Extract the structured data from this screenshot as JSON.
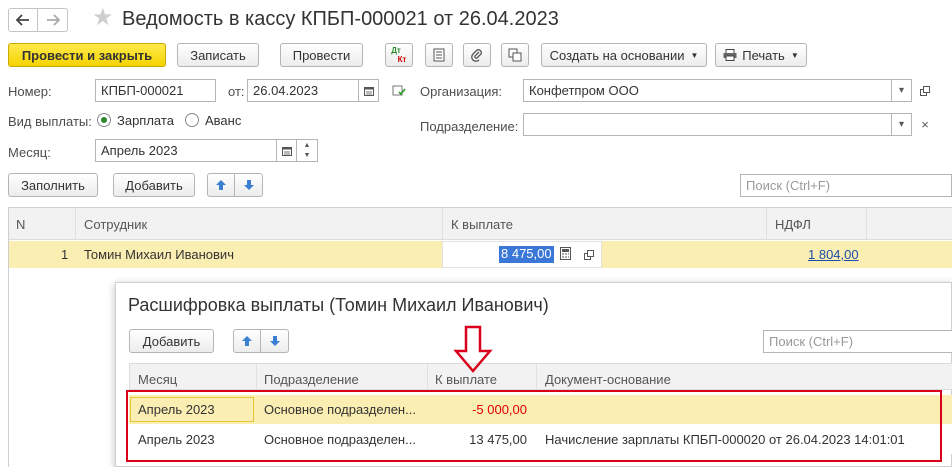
{
  "window": {
    "title": "Ведомость в кассу КПБП-000021 от 26.04.2023"
  },
  "toolbar": {
    "post_close": "Провести и закрыть",
    "save": "Записать",
    "post": "Провести",
    "dtkt_top": "Дт",
    "dtkt_bottom": "Кт",
    "create_based": "Создать на основании",
    "print": "Печать"
  },
  "form": {
    "number_label": "Номер:",
    "number_value": "КПБП-000021",
    "from_label": "от:",
    "date_value": "26.04.2023",
    "org_label": "Организация:",
    "org_value": "Конфетпром ООО",
    "pay_type_label": "Вид выплаты:",
    "pay_type_salary": "Зарплата",
    "pay_type_advance": "Аванс",
    "dept_label": "Подразделение:",
    "dept_value": "",
    "month_label": "Месяц:",
    "month_value": "Апрель 2023"
  },
  "actions": {
    "fill": "Заполнить",
    "add": "Добавить",
    "search_placeholder": "Поиск (Ctrl+F)"
  },
  "main_table": {
    "headers": {
      "n": "N",
      "employee": "Сотрудник",
      "to_pay": "К выплате",
      "ndfl": "НДФЛ"
    },
    "rows": [
      {
        "n": "1",
        "employee": "Томин Михаил Иванович",
        "to_pay": "8 475,00",
        "ndfl": "1 804,00"
      }
    ]
  },
  "popup": {
    "title": "Расшифровка выплаты (Томин Михаил Иванович)",
    "add": "Добавить",
    "search_placeholder": "Поиск (Ctrl+F)",
    "headers": {
      "month": "Месяц",
      "dept": "Подразделение",
      "to_pay": "К выплате",
      "doc": "Документ-основание"
    },
    "rows": [
      {
        "month": "Апрель 2023",
        "dept": "Основное подразделен...",
        "to_pay": "-5 000,00",
        "doc": ""
      },
      {
        "month": "Апрель 2023",
        "dept": "Основное подразделен...",
        "to_pay": "13 475,00",
        "doc": "Начисление зарплаты КПБП-000020 от 26.04.2023 14:01:01"
      }
    ]
  },
  "colors": {
    "accent_yellow": "#f5d300",
    "selected_row": "#fbeeb3",
    "negative": "#e10000",
    "annotation_red": "#d9001b",
    "link": "#1a4ea8"
  }
}
